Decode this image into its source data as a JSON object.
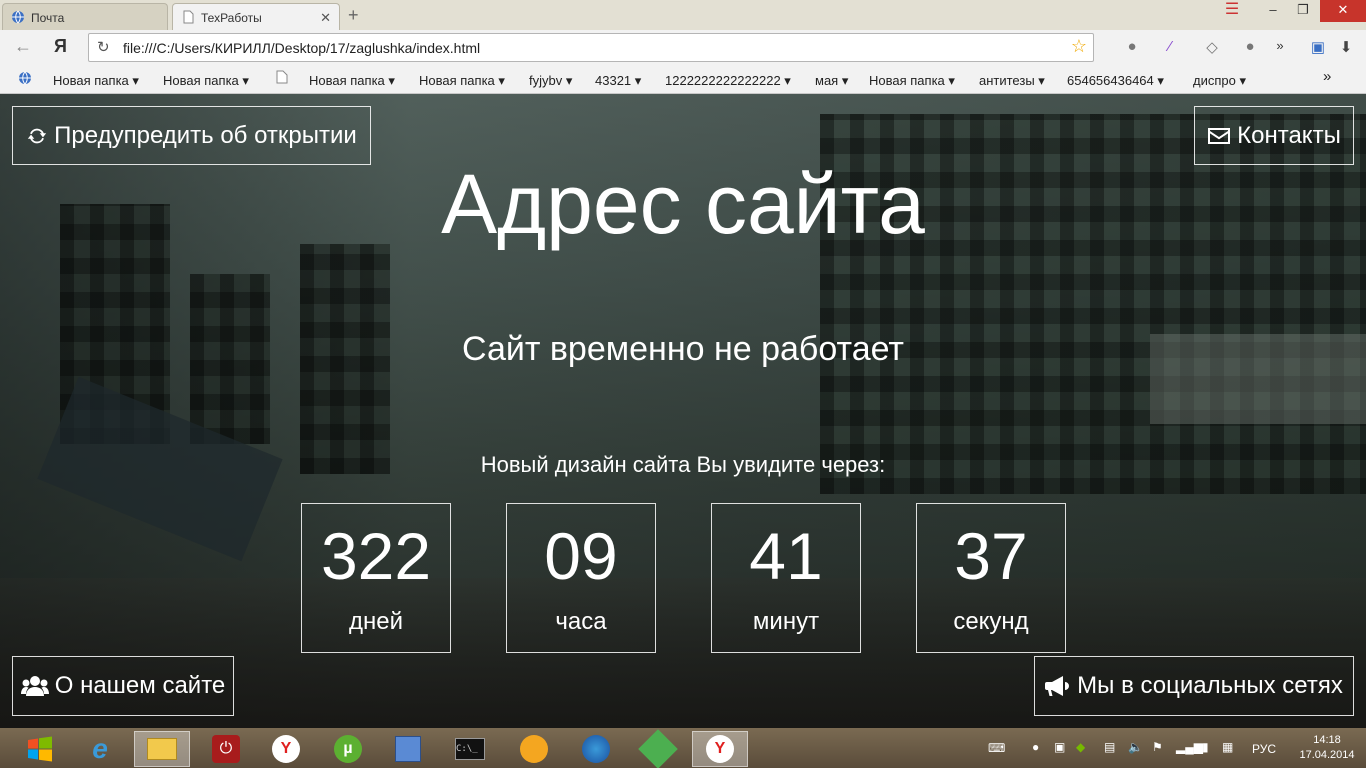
{
  "browser": {
    "tabs": [
      {
        "label": "Почта",
        "active": false
      },
      {
        "label": "ТехРаботы",
        "active": true
      }
    ],
    "address": "file:///C:/Users/КИРИЛЛ/Desktop/17/zaglushka/index.html",
    "bookmarks": [
      "Новая папка ▾",
      "Новая папка ▾",
      "Новая папка ▾",
      "Новая папка ▾",
      "fyjybv ▾",
      "43321 ▾",
      "1222222222222222 ▾",
      "мая ▾",
      "Новая папка ▾",
      "антитезы ▾",
      "654656436464 ▾",
      "диспро ▾"
    ],
    "bookmarks_more": "»"
  },
  "page": {
    "notify_button": "Предупредить об открытии",
    "contacts_button": "Контакты",
    "title": "Адрес сайта",
    "subtitle": "Сайт временно не работает",
    "countdown_caption": "Новый дизайн сайта Вы увидите через:",
    "countdown": [
      {
        "value": "322",
        "unit": "дней"
      },
      {
        "value": "09",
        "unit": "часа"
      },
      {
        "value": "41",
        "unit": "минут"
      },
      {
        "value": "37",
        "unit": "секунд"
      }
    ],
    "about_button": "О нашем сайте",
    "social_button": "Мы в социальных сетях"
  },
  "taskbar": {
    "language": "РУС",
    "time": "14:18",
    "date": "17.04.2014"
  },
  "colors": {
    "accent_close": "#c7342b",
    "text_on_page": "#ffffff",
    "star": "#f0a800"
  }
}
